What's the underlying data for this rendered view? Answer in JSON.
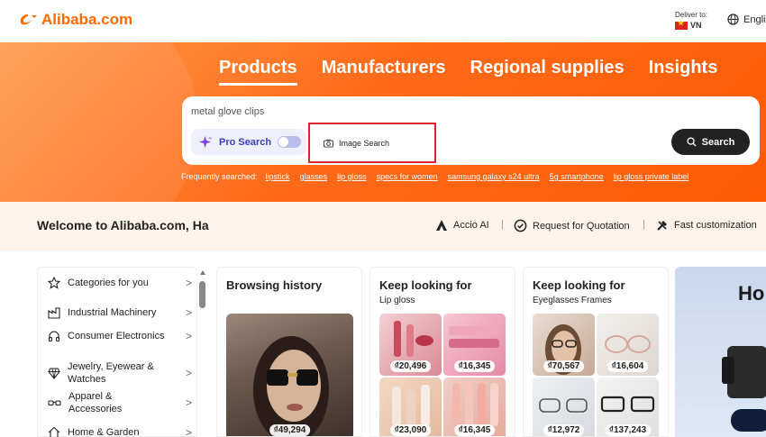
{
  "header": {
    "logo_text": "Alibaba.com",
    "deliver_label": "Deliver to:",
    "deliver_country": "VN",
    "language": "English"
  },
  "hero": {
    "tabs": [
      "Products",
      "Manufacturers",
      "Regional supplies",
      "Insights"
    ],
    "search_value": "metal glove clips",
    "pro_search_label": "Pro Search",
    "image_search_label": "Image Search",
    "search_button": "Search",
    "frequently_label": "Frequently searched:",
    "frequent_links": [
      "lipstick",
      "glasses",
      "lip gloss",
      "specs for women",
      "samsung galaxy s24 ultra",
      "5g smartphone",
      "lip gloss private label"
    ]
  },
  "welcome": {
    "text": "Welcome to Alibaba.com, Ha",
    "accio": "Accio AI",
    "rfq": "Request for Quotation",
    "custom": "Fast customization"
  },
  "categories": [
    "Categories for you",
    "Industrial Machinery",
    "Consumer Electronics",
    "Jewelry, Eyewear & Watches",
    "Apparel & Accessories",
    "Home & Garden"
  ],
  "cards": {
    "history": {
      "title": "Browsing history",
      "price": "₫49,294"
    },
    "lipgloss": {
      "title": "Keep looking for",
      "subtitle": "Lip gloss",
      "prices": [
        "₫20,496",
        "₫16,345",
        "₫23,090",
        "₫16,345"
      ]
    },
    "eyeglasses": {
      "title": "Keep looking for",
      "subtitle": "Eyeglasses Frames",
      "prices": [
        "₫70,567",
        "₫16,604",
        "₫12,972",
        "₫137,243"
      ]
    }
  },
  "banner": {
    "text": "Ho"
  },
  "colors": {
    "brand": "#ff6a00",
    "highlight_box": "#d9262c",
    "pro_search": "#3a3fbd"
  }
}
